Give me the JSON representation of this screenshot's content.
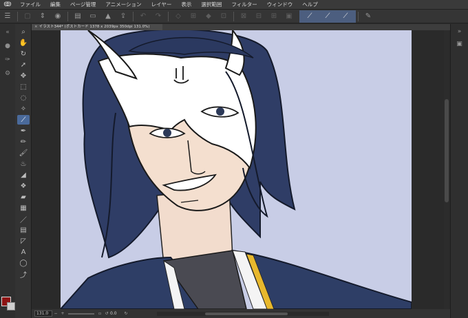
{
  "menu": {
    "items": [
      "ファイル",
      "編集",
      "ページ管理",
      "アニメーション",
      "レイヤー",
      "表示",
      "選択範囲",
      "フィルター",
      "ウィンドウ",
      "ヘルプ"
    ]
  },
  "document": {
    "tab_label": "イラスト344* (ポストカード 1378 x 2039px 350dpi 131.0%)"
  },
  "status": {
    "zoom": "131.0",
    "angle": "0.0"
  },
  "colors": {
    "main_color": "#8e1414",
    "sub_color": "#cfcfcf",
    "canvas_bg": "#c8cde6",
    "accent": "#4c5e7f"
  },
  "icons": {
    "tools": [
      "zoom-icon",
      "hand-icon",
      "rotate-icon",
      "operation-icon",
      "move-layer-icon",
      "selection-icon",
      "lasso-icon",
      "eyedropper-icon",
      "pen-icon",
      "pencil-icon",
      "brush-icon",
      "airbrush-icon",
      "eraser-icon",
      "fill-icon",
      "gradient-icon",
      "figure-icon",
      "frame-icon",
      "ruler-icon",
      "text-icon",
      "balloon-icon",
      "correction-icon"
    ]
  }
}
